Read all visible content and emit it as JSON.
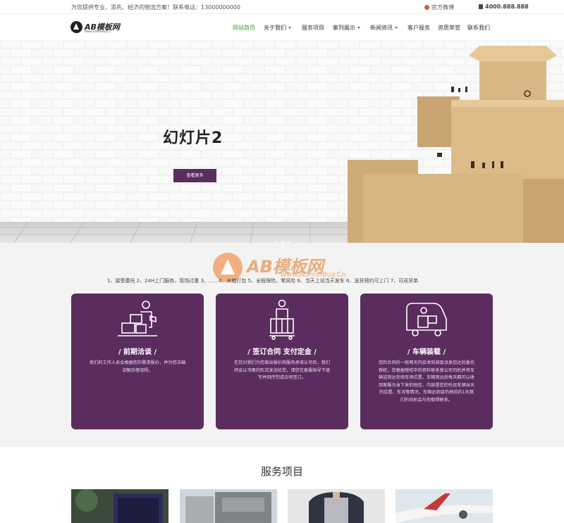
{
  "topbar": {
    "slogan": "为您提供专业、添先、经济的物流方案！联系电话：13000000000",
    "weibo": "官方微博",
    "phone": "4000.888.888"
  },
  "logo": {
    "name": "AB模板网",
    "sub": "Www.Admin8uy.Cn"
  },
  "nav": [
    {
      "label": "网站首页",
      "active": true,
      "dropdown": false
    },
    {
      "label": "关于我们",
      "active": false,
      "dropdown": true
    },
    {
      "label": "服务项目",
      "active": false,
      "dropdown": false
    },
    {
      "label": "案列展示",
      "active": false,
      "dropdown": true
    },
    {
      "label": "新闻资讯",
      "active": false,
      "dropdown": true
    },
    {
      "label": "客户服务",
      "active": false,
      "dropdown": false
    },
    {
      "label": "资质荣誉",
      "active": false,
      "dropdown": false
    },
    {
      "label": "联系我们",
      "active": false,
      "dropdown": false
    }
  ],
  "banner": {
    "title": "幻灯片2",
    "button": "查看更多",
    "slide_count": 3,
    "active_slide": 2
  },
  "watermark": {
    "text": "AB模板网",
    "url": "www.AdminBuy.Cn"
  },
  "services": {
    "intro": "1、接受委托 2、24H上门服务，现场过重 3、……4、木箱打包 5、全程保险，零风险 6、当天上站当天发车 6、送货预约可上门 7、可返货单",
    "cards": [
      {
        "title": "/  前期洽谈  /",
        "desc": "我们的工作人员会根据您的需求报价，并为您详细讲解办理流程。"
      },
      {
        "title": "/  签订合同 支付定金  /",
        "desc": "在您对我们为您做出报价和服务承诺认可后，我们将会以书面的形式发送给您，请您在客服指导下填写并回传完成合同签订。"
      },
      {
        "title": "/  车辆装载  /",
        "desc": "您的合同后一般两天内会收到调度派发您达的委托授权，您根据授权中的资料联系我公司司机并将车辆送到达到场车场位置，车辆到达后每天都可以收到客服为当下发的短信，内容是您的托运车辆当天的位置、车况等情况，车辆达到目的地前的1天我们的司机会与你取得联系。"
      }
    ]
  },
  "projects": {
    "title": "服务项目"
  },
  "colors": {
    "brand": "#5b2c5e",
    "nav_active": "#3c9a3c",
    "section_bg": "#f3f3f3"
  }
}
